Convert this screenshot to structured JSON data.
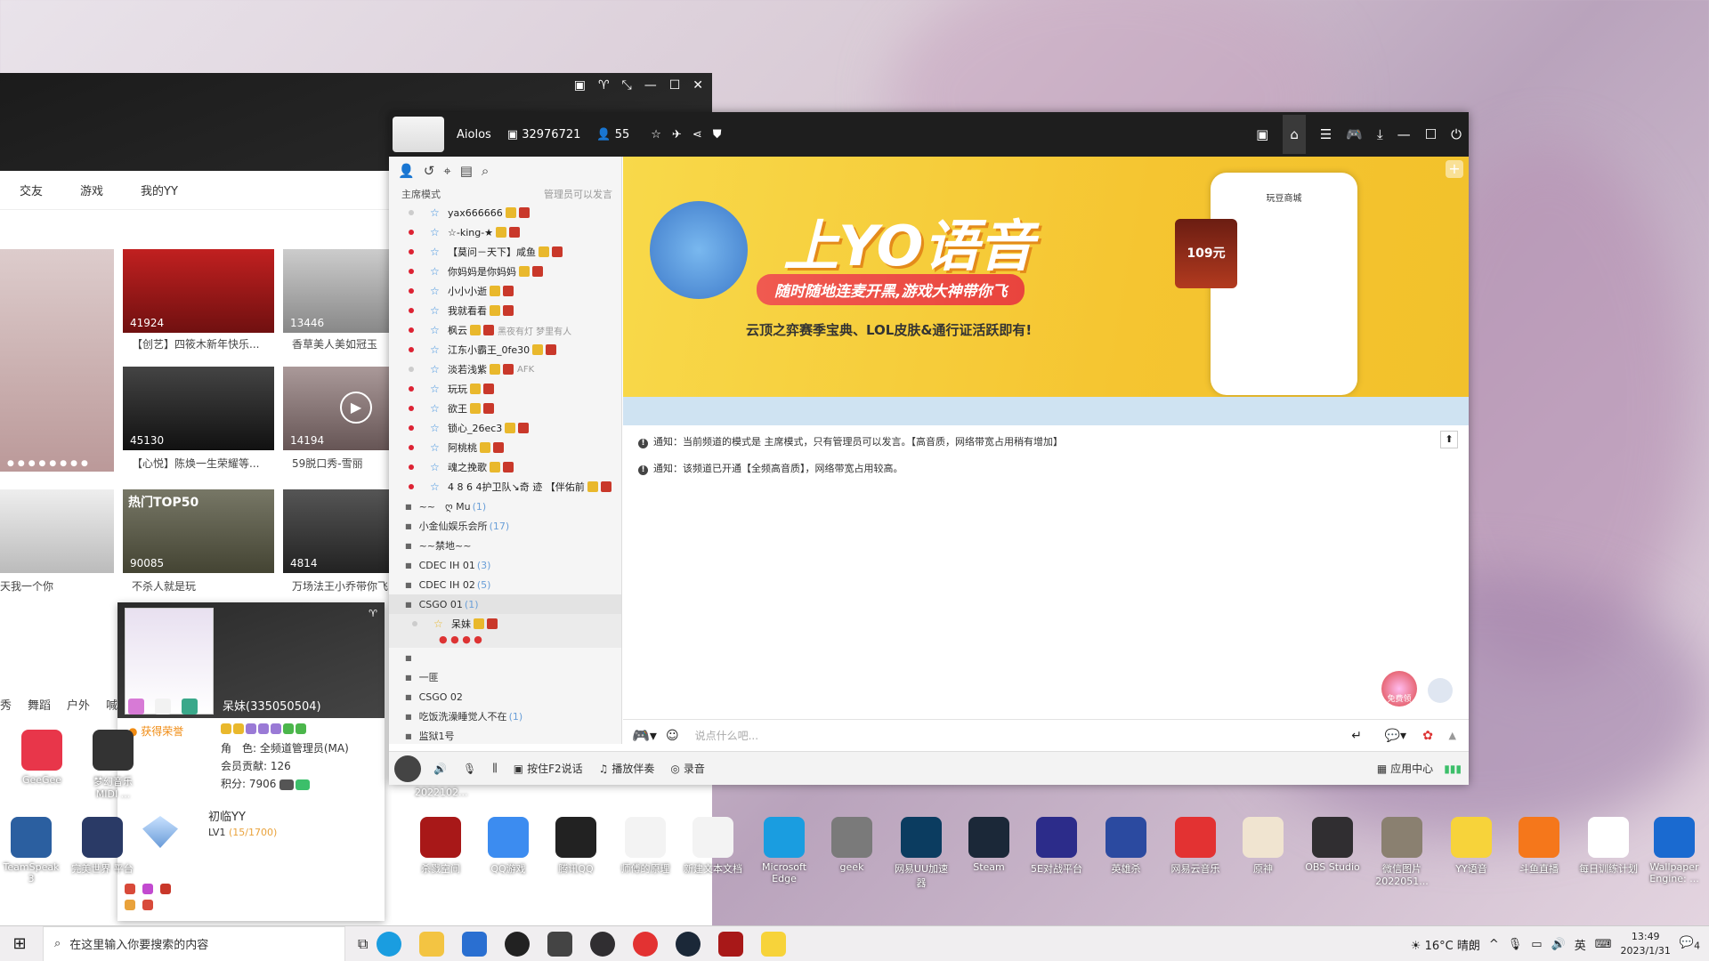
{
  "left_window": {
    "nav": [
      "交友",
      "游戏",
      "我的YY"
    ],
    "tiles": [
      {
        "count": "41924",
        "caption": "【创艺】四筱木新年快乐..."
      },
      {
        "count": "13446",
        "caption": "香草美人美如冠玉"
      },
      {
        "count": "45130",
        "caption": "【心悦】陈焕一生荣耀等..."
      },
      {
        "count": "14194",
        "caption": "59脱口秀-雪丽"
      },
      {
        "count": "90085",
        "caption": "不杀人就是玩"
      },
      {
        "count": "4814",
        "caption": "万场法王小乔带你飞"
      }
    ],
    "side_caption": "天我一个你",
    "overlay_text": "热门TOP50",
    "categories": [
      "秀",
      "舞蹈",
      "户外",
      "喊"
    ]
  },
  "profile": {
    "name": "呆妹(335050504)",
    "honor": "获得荣誉",
    "role_label": "角　色:",
    "role_value": "全频道管理员(MA)",
    "contrib_label": "会员贡献:",
    "contrib_value": "126",
    "points_label": "积分:",
    "points_value": "7906",
    "brand": "初临YY",
    "level": "LV1",
    "progress_text": "(15/1700)"
  },
  "yy": {
    "user": "Aiolos",
    "channel_id": "32976721",
    "online": "55",
    "mode": "主席模式",
    "mode_right": "管理员可以发言",
    "members": [
      {
        "name": "yax666666",
        "dot": "g"
      },
      {
        "name": "☆-king-★",
        "dot": "r"
      },
      {
        "name": "【莫问－天下】咸鱼",
        "dot": "r"
      },
      {
        "name": "你妈妈是你妈妈",
        "dot": "r"
      },
      {
        "name": "小小小逝",
        "dot": "r"
      },
      {
        "name": "我就看看",
        "dot": "r"
      },
      {
        "name": "枫云",
        "extra": "黑夜有灯 梦里有人",
        "dot": "r"
      },
      {
        "name": "江东小霸王_0fe30",
        "dot": "r"
      },
      {
        "name": "淡若浅紫",
        "extra": "AFK",
        "dot": "g"
      },
      {
        "name": "玩玩",
        "dot": "r"
      },
      {
        "name": "欲王",
        "dot": "r"
      },
      {
        "name": "锁心_26ec3",
        "dot": "r"
      },
      {
        "name": "阿桃桃",
        "dot": "r"
      },
      {
        "name": "魂之挽歌",
        "dot": "r"
      },
      {
        "name": "4 8 6 4护卫队↘奇 迹 【伴佑前",
        "dot": "r"
      }
    ],
    "channels": [
      {
        "name": "~~　ღ Mu",
        "count": "(1)"
      },
      {
        "name": "小金仙娱乐会所",
        "count": "(17)"
      },
      {
        "name": "~~禁地~~",
        "count": ""
      },
      {
        "name": "CDEC IH 01",
        "count": "(3)"
      },
      {
        "name": "CDEC IH 02",
        "count": "(5)"
      },
      {
        "name": "CSGO 01",
        "count": "(1)"
      }
    ],
    "sub_member": "呆妹",
    "channels2": [
      {
        "name": "",
        "count": ""
      },
      {
        "name": "一匪",
        "count": ""
      },
      {
        "name": "CSGO 02",
        "count": ""
      },
      {
        "name": "吃饭洗澡睡觉人不在",
        "count": "(1)"
      },
      {
        "name": "监狱1号",
        "count": ""
      }
    ],
    "banner_title": "上YO语音",
    "banner_pill": "随时随地连麦开黑,游戏大神带你飞",
    "banner_sub": "云顶之弈赛季宝典、LOL皮肤&通行证活跃即有!",
    "banner_phone_title": "玩豆商城",
    "banner_badge": "109元",
    "notices": [
      "通知：当前频道的模式是 主席模式，只有管理员可以发言。【高音质，网络带宽占用稍有增加】",
      "通知：该频道已开通【全频高音质】，网络带宽占用较高。"
    ],
    "input_placeholder": "说点什么吧...",
    "bottom": {
      "ptt": "按住F2说话",
      "accompany": "播放伴奏",
      "record": "录音",
      "app_center": "应用中心"
    },
    "free_gift": "免费领"
  },
  "desktop_icons": [
    {
      "label": "GeeGee",
      "color": "#e8364a"
    },
    {
      "label": "梦幻音乐 MIDI ...",
      "color": "#333"
    },
    {
      "label": "TeamSpeak 3",
      "color": "#2b5fa0"
    },
    {
      "label": "完美世界 平台",
      "color": "#2a3a66"
    },
    {
      "label": "杀戮空间",
      "color": "#a81818"
    },
    {
      "label": "QQ游戏",
      "color": "#3c8cf0"
    },
    {
      "label": "腾讯QQ",
      "color": "#222"
    },
    {
      "label": "师傅的原理",
      "color": "#f3f3f3"
    },
    {
      "label": "新建文本文档",
      "color": "#f3f3f3"
    },
    {
      "label": "Microsoft Edge",
      "color": "#1a9de0"
    },
    {
      "label": "geek",
      "color": "#7a7a7a"
    },
    {
      "label": "网易UU加速器",
      "color": "#0b3c60"
    },
    {
      "label": "Steam",
      "color": "#1b2838"
    },
    {
      "label": "5E对战平台",
      "color": "#2c2c8a"
    },
    {
      "label": "英雄杀",
      "color": "#2b4aa0"
    },
    {
      "label": "网易云音乐",
      "color": "#e33232"
    },
    {
      "label": "原神",
      "color": "#f0e4d0"
    },
    {
      "label": "OBS Studio",
      "color": "#302e31"
    },
    {
      "label": "微信图片 2022051...",
      "color": "#8a8070"
    },
    {
      "label": "YY语音",
      "color": "#f7d33a"
    },
    {
      "label": "斗鱼直播",
      "color": "#f5771b"
    },
    {
      "label": "每日训练计划",
      "color": "#ffffff"
    },
    {
      "label": "Wallpaper Engine: ...",
      "color": "#1a6ad0"
    }
  ],
  "yy_thumb_caption": "2022102...",
  "taskbar": {
    "search_placeholder": "在这里输入你要搜索的内容",
    "weather": "16°C 晴朗",
    "ime": "英",
    "time": "13:49",
    "date": "2023/1/31",
    "notify_count": "4"
  }
}
